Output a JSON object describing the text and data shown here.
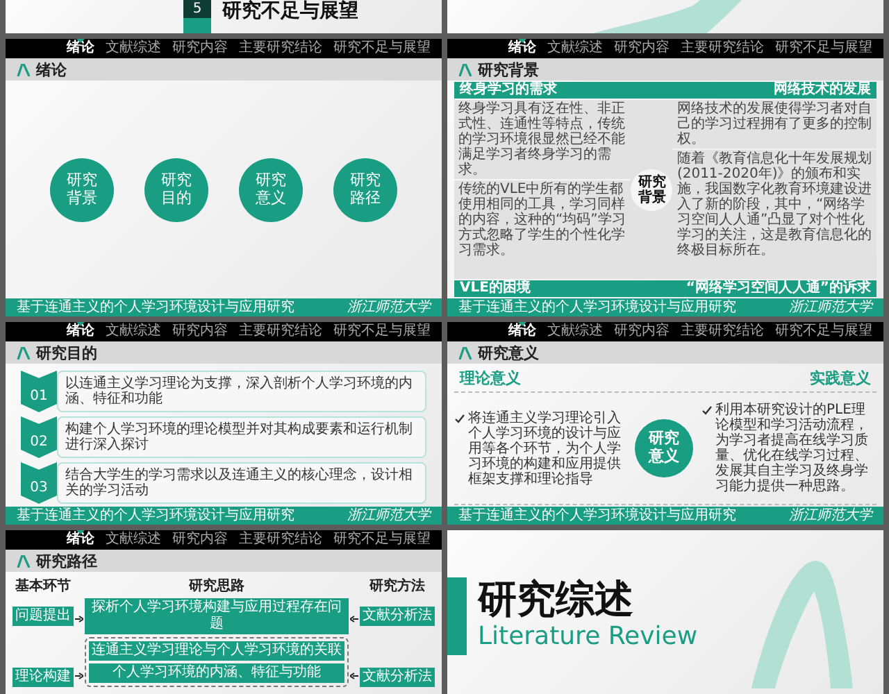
{
  "slides": [
    {
      "kind": "section",
      "number": "5",
      "title": "研究不足与展望"
    },
    {
      "kind": "art"
    },
    {
      "kind": "circles",
      "nav": [
        {
          "label": "绪论",
          "selected": true
        },
        {
          "label": "文献综述",
          "selected": false
        },
        {
          "label": "研究内容",
          "selected": false
        },
        {
          "label": "主要研究结论",
          "selected": false
        },
        {
          "label": "研究不足与展望",
          "selected": false
        }
      ],
      "title": "绪论",
      "circles": [
        "研究背景",
        "研究目的",
        "研究意义",
        "研究路径"
      ],
      "footer": {
        "caption": "基于连通主义的个人学习环境设计与应用研究",
        "logo": "浙江师范大学"
      }
    },
    {
      "kind": "quadrants",
      "nav": [
        {
          "label": "绪论",
          "selected": true
        },
        {
          "label": "文献综述",
          "selected": false
        },
        {
          "label": "研究内容",
          "selected": false
        },
        {
          "label": "主要研究结论",
          "selected": false
        },
        {
          "label": "研究不足与展望",
          "selected": false
        }
      ],
      "title": "研究背景",
      "center": "研究背景",
      "cells": [
        {
          "heading": "终身学习的需求",
          "text": "终身学习具有泛在性、非正式性、连通性等特点，传统的学习环境很显然已经不能满足学习者终身学习的需求。"
        },
        {
          "heading": "VLE的困境",
          "text": "传统的VLE中所有的学生都使用相同的工具，学习同样的内容，这种的“均码”学习方式忽略了学生的个性化学习需求。"
        },
        {
          "heading": "网络技术的发展",
          "text": "网络技术的发展使得学习者对自己的学习过程拥有了更多的控制权。"
        },
        {
          "heading": "“网络学习空间人人通”的诉求",
          "text": "随着《教育信息化十年发展规划(2011-2020年)》的颁布和实施，我国数字化教育环境建设进入了新的阶段，其中，“网络学习空间人人通”凸显了对个性化学习的关注，这是教育信息化的终极目标所在。"
        }
      ],
      "footer": {
        "caption": "基于连通主义的个人学习环境设计与应用研究",
        "logo": "浙江师范大学"
      }
    },
    {
      "kind": "goals",
      "nav": [
        {
          "label": "绪论",
          "selected": true
        },
        {
          "label": "文献综述",
          "selected": false
        },
        {
          "label": "研究内容",
          "selected": false
        },
        {
          "label": "主要研究结论",
          "selected": false
        },
        {
          "label": "研究不足与展望",
          "selected": false
        }
      ],
      "title": "研究目的",
      "items": [
        {
          "number": "01",
          "text": "以连通主义学习理论为支撑，深入剖析个人学习环境的内涵、特征和功能"
        },
        {
          "number": "02",
          "text": "构建个人学习环境的理论模型并对其构成要素和运行机制进行深入探讨"
        },
        {
          "number": "03",
          "text": "结合大学生的学习需求以及连通主义的核心理念，设计相关的学习活动"
        }
      ],
      "footer": {
        "caption": "基于连通主义的个人学习环境设计与应用研究",
        "logo": "浙江师范大学"
      }
    },
    {
      "kind": "significance",
      "nav": [
        {
          "label": "绪论",
          "selected": true
        },
        {
          "label": "文献综述",
          "selected": false
        },
        {
          "label": "研究内容",
          "selected": false
        },
        {
          "label": "主要研究结论",
          "selected": false
        },
        {
          "label": "研究不足与展望",
          "selected": false
        }
      ],
      "title": "研究意义",
      "center": "研究意义",
      "columns": [
        {
          "heading": "理论意义",
          "text": "将连通主义学习理论引入个人学习环境的设计与应用等各个环节，为个人学习环境的构建和应用提供框架支撑和理论指导"
        },
        {
          "heading": "实践意义",
          "text": "利用本研究设计的PLE理论模型和学习活动流程，为学习者提高在线学习质量、优化在线学习过程、发展其自主学习及终身学习能力提供一种思路。"
        }
      ],
      "footer": {
        "caption": "基于连通主义的个人学习环境设计与应用研究",
        "logo": "浙江师范大学"
      }
    },
    {
      "kind": "roadmap",
      "nav": [
        {
          "label": "绪论",
          "selected": true
        },
        {
          "label": "文献综述",
          "selected": false
        },
        {
          "label": "研究内容",
          "selected": false
        },
        {
          "label": "主要研究结论",
          "selected": false
        },
        {
          "label": "研究不足与展望",
          "selected": false
        }
      ],
      "title": "研究路径",
      "headers": [
        "基本环节",
        "研究思路",
        "研究方法"
      ],
      "steps": [
        {
          "stage": "问题提出",
          "ideas": [
            "探析个人学习环境构建与应用过程存在问题"
          ],
          "method": "文献分析法"
        },
        {
          "stage": "理论构建",
          "ideas": [
            "连通主义学习理论与个人学习环境的关联",
            "个人学习环境的内涵、特征与功能"
          ],
          "method": "文献分析法"
        }
      ]
    },
    {
      "kind": "chapter",
      "title": "研究综述",
      "subtitle": "Literature Review"
    }
  ]
}
